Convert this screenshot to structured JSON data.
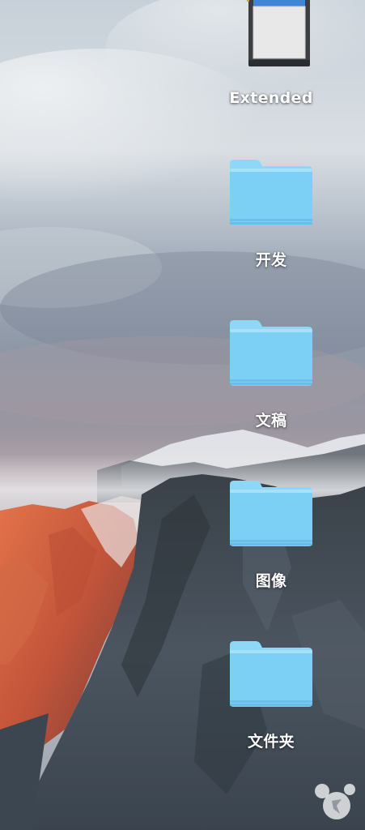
{
  "desktop": {
    "icons": [
      {
        "label": "Extended",
        "icon": "sd-card-drive-icon"
      },
      {
        "label": "开发",
        "icon": "folder-icon"
      },
      {
        "label": "文稿",
        "icon": "folder-icon"
      },
      {
        "label": "图像",
        "icon": "folder-icon"
      },
      {
        "label": "文件夹",
        "icon": "folder-icon"
      }
    ]
  },
  "colors": {
    "folder_body": "#7ccff5",
    "folder_tab": "#8fd7f7",
    "label_text": "#ffffff",
    "drive_blue": "#3f86d6"
  }
}
